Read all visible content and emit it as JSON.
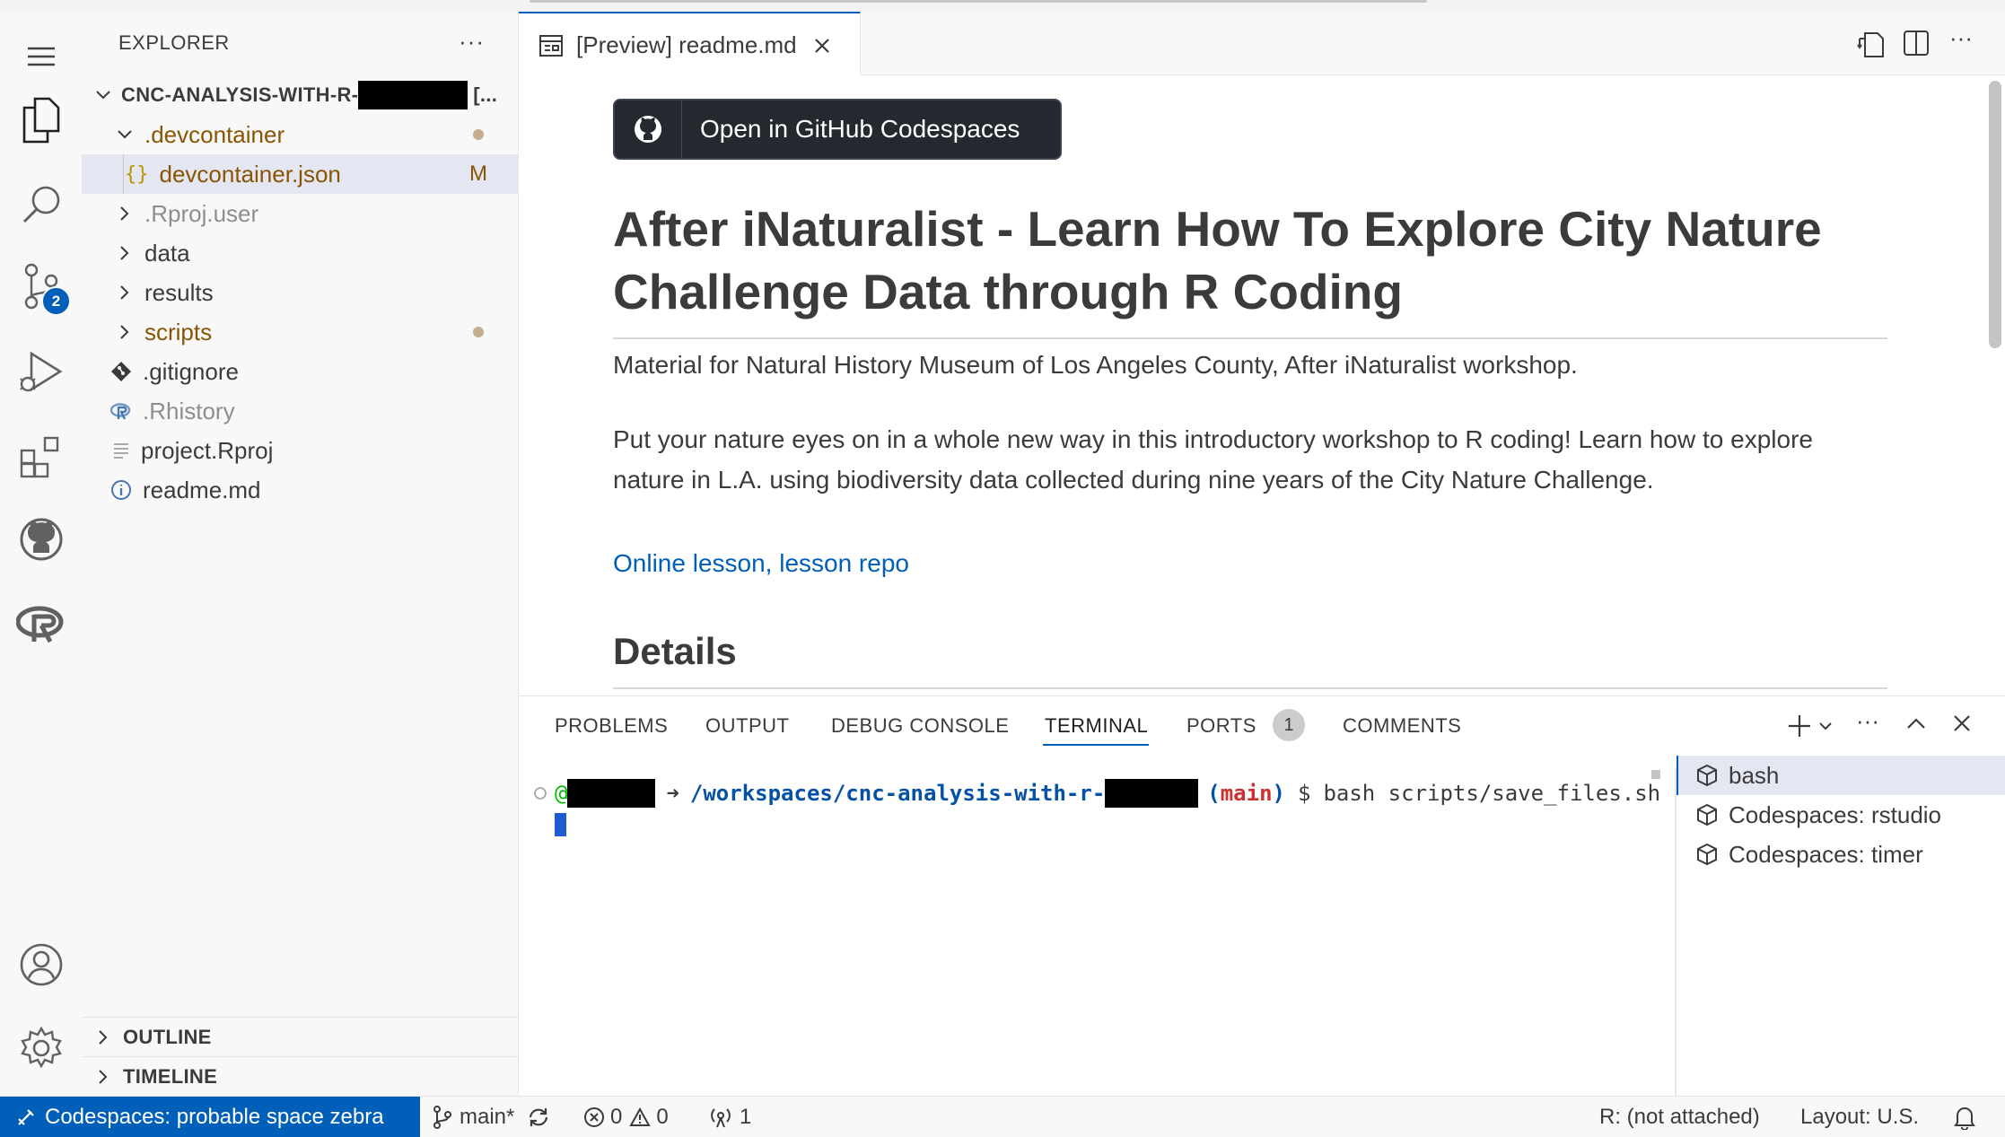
{
  "activity_bar": {
    "scm_badge": "2",
    "items": [
      "explorer-icon",
      "search-icon",
      "source-control-icon",
      "run-debug-icon",
      "extensions-icon",
      "github-icon",
      "r-icon",
      "account-icon",
      "settings-gear-icon"
    ]
  },
  "sidebar": {
    "title": "EXPLORER",
    "more": "···",
    "root_label_prefix": "CNC-ANALYSIS-WITH-R-",
    "root_label_suffix": "[...",
    "tree": [
      {
        "label": ".devcontainer",
        "type": "folder-open",
        "status": "dot",
        "color": "#895503"
      },
      {
        "label": "devcontainer.json",
        "type": "json",
        "status": "M",
        "color": "#895503"
      },
      {
        "label": ".Rproj.user",
        "type": "folder",
        "color": "#8e8e8e"
      },
      {
        "label": "data",
        "type": "folder",
        "color": "#3b3b3b"
      },
      {
        "label": "results",
        "type": "folder",
        "color": "#3b3b3b"
      },
      {
        "label": "scripts",
        "type": "folder",
        "status": "dot",
        "color": "#895503"
      },
      {
        "label": ".gitignore",
        "type": "git",
        "color": "#3b3b3b"
      },
      {
        "label": ".Rhistory",
        "type": "r",
        "color": "#8e8e8e"
      },
      {
        "label": "project.Rproj",
        "type": "lines",
        "color": "#3b3b3b"
      },
      {
        "label": "readme.md",
        "type": "info",
        "color": "#3b3b3b"
      }
    ],
    "sections": [
      "OUTLINE",
      "TIMELINE"
    ]
  },
  "editor": {
    "tab_label": "[Preview] readme.md",
    "codespaces_button": "Open in GitHub Codespaces",
    "h1": "After iNaturalist - Learn How To Explore City Nature Challenge Data through R Coding",
    "p1": "Material for Natural History Museum of Los Angeles County, After iNaturalist workshop.",
    "p2": "Put your nature eyes on in a whole new way in this introductory workshop to R coding! Learn how to explore nature in L.A. using biodiversity data collected during nine years of the City Nature Challenge.",
    "link1": "Online lesson",
    "link_sep": ", ",
    "link2": "lesson repo",
    "h2": "Details"
  },
  "panel": {
    "tabs": [
      "PROBLEMS",
      "OUTPUT",
      "DEBUG CONSOLE",
      "TERMINAL",
      "PORTS",
      "COMMENTS"
    ],
    "ports_badge": "1",
    "terminal": {
      "at": "@",
      "arrow": "➜",
      "path": "/workspaces/cnc-analysis-with-r-",
      "branch_open": "(",
      "branch": "main",
      "branch_close": ")",
      "prompt": "$",
      "command": "bash scripts/save_files.sh"
    },
    "terminal_list": [
      "bash",
      "Codespaces: rstudio",
      "Codespaces: timer"
    ]
  },
  "status_bar": {
    "remote": "Codespaces: probable space zebra",
    "branch": "main*",
    "errors": "0",
    "warnings": "0",
    "ports": "1",
    "r_status": "R: (not attached)",
    "layout": "Layout: U.S."
  },
  "colors": {
    "accent": "#005fb8",
    "modified": "#895503",
    "link": "#005fb8"
  }
}
